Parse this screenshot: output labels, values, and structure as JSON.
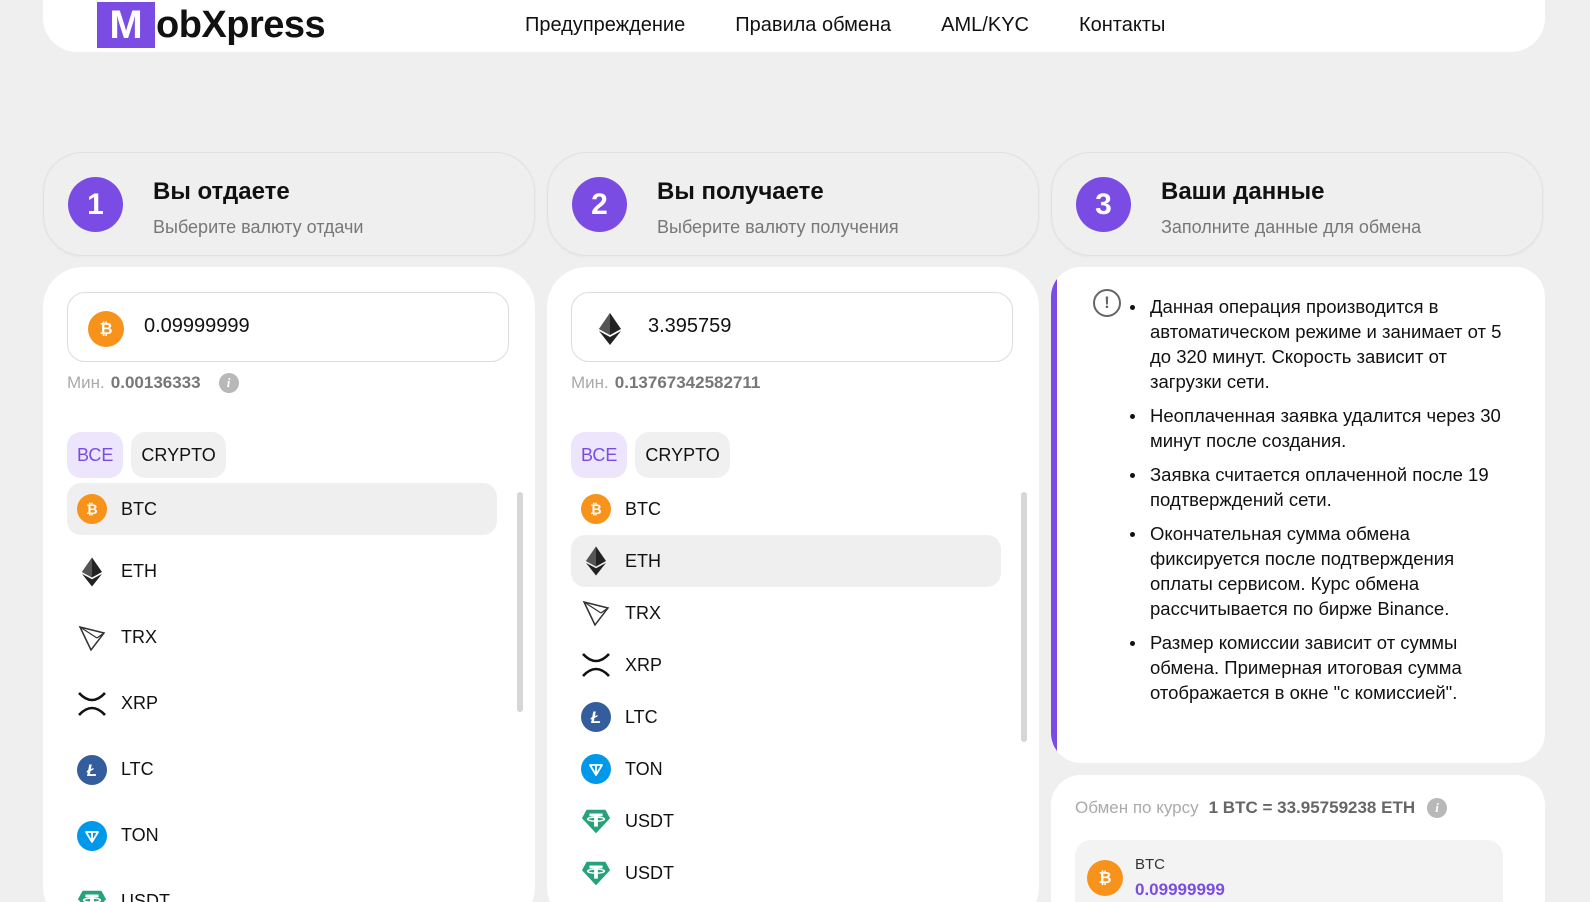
{
  "header": {
    "logo_letter": "M",
    "logo_rest": "obXpress",
    "nav": [
      "Предупреждение",
      "Правила обмена",
      "AML/KYC",
      "Контакты"
    ]
  },
  "steps": [
    {
      "num": "1",
      "title": "Вы отдаете",
      "subtitle": "Выберите валюту отдачи"
    },
    {
      "num": "2",
      "title": "Вы получаете",
      "subtitle": "Выберите валюту получения"
    },
    {
      "num": "3",
      "title": "Ваши данные",
      "subtitle": "Заполните данные для обмена"
    }
  ],
  "give": {
    "coin_icon": "btc-icon",
    "amount": "0.09999999",
    "min_label": "Мин.",
    "min_value": "0.00136333",
    "filters": [
      "ВСЕ",
      "CRYPTO"
    ],
    "selected": "BTC",
    "currencies": [
      "BTC",
      "ETH",
      "TRX",
      "XRP",
      "LTC",
      "TON",
      "USDT"
    ]
  },
  "get": {
    "coin_icon": "eth-icon",
    "amount": "3.395759",
    "min_label": "Мин.",
    "min_value": "0.13767342582711",
    "filters": [
      "ВСЕ",
      "CRYPTO"
    ],
    "selected": "ETH",
    "currencies": [
      "BTC",
      "ETH",
      "TRX",
      "XRP",
      "LTC",
      "TON",
      "USDT",
      "USDT"
    ]
  },
  "info": {
    "items": [
      "Данная операция производится в автоматическом режиме и занимает от 5 до 320 минут. Скорость зависит от загрузки сети.",
      "Неоплаченная заявка удалится через 30 минут после создания.",
      "Заявка считается оплаченной после 19 подтверждений сети.",
      "Окончательная сумма обмена фиксируется после подтверждения оплаты сервисом. Курс обмена рассчитывается по бирже Binance.",
      "Размер комиссии зависит от суммы обмена. Примерная итоговая сумма отображается в окне \"с комиссией\"."
    ]
  },
  "rate": {
    "label": "Обмен по курсу",
    "value": "1 BTC = 33.95759238 ETH",
    "send_symbol": "BTC",
    "send_amount": "0.09999999"
  },
  "colors": {
    "accent": "#7b4ce4",
    "btc": "#f7931a",
    "ltc": "#345d9d",
    "ton": "#0098ea",
    "usdt": "#26a17b"
  }
}
